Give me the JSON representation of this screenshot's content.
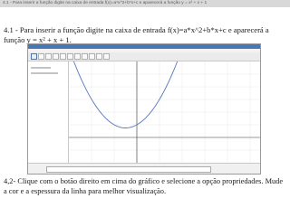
{
  "header": {
    "title": "4.1 - Para inserir a função digite na caixa de entrada f(x)=a*x^2+b*x+c e aparecerá a função y = x² + x + 1"
  },
  "instructions": {
    "step1": "4.1 - Para inserir a função digite na caixa de entrada f(x)=a*x^2+b*x+c e aparecerá a função y = x² + x + 1.",
    "step2": "4,2- Clique com o botão direito em cima do gráfico e selecione a opção propriedades. Mude a cor e a espessura da linha para melhor visualização."
  },
  "graph": {
    "curve_color": "#5577bb",
    "axis_color": "#333333",
    "grid_color": "#e2e2e2"
  }
}
